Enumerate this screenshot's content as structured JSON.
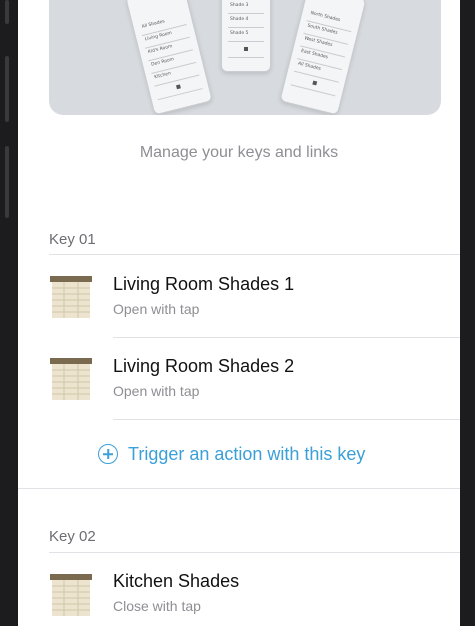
{
  "hero": {
    "remote_left_labels": [
      "All Shades",
      "Living Room",
      "Kid's Room",
      "Den Room",
      "Kitchen"
    ],
    "remote_middle_labels": [
      "Shade 3",
      "Shade 4",
      "Shade 5"
    ],
    "remote_right_labels": [
      "North Shades",
      "South Shades",
      "West Shades",
      "East Shades",
      "All Shades"
    ]
  },
  "subtitle": "Manage your keys and links",
  "sections": [
    {
      "header": "Key 01",
      "items": [
        {
          "title": "Living Room Shades 1",
          "subtitle": "Open with tap",
          "icon": "shade-icon"
        },
        {
          "title": "Living Room Shades 2",
          "subtitle": "Open with tap",
          "icon": "shade-icon"
        }
      ],
      "action": {
        "label": "Trigger an action with this key",
        "icon": "plus-circle-icon"
      }
    },
    {
      "header": "Key 02",
      "items": [
        {
          "title": "Kitchen Shades",
          "subtitle": "Close with tap",
          "icon": "shade-icon"
        }
      ]
    }
  ],
  "colors": {
    "accent": "#3b9fd8",
    "background": "#ffffff"
  }
}
